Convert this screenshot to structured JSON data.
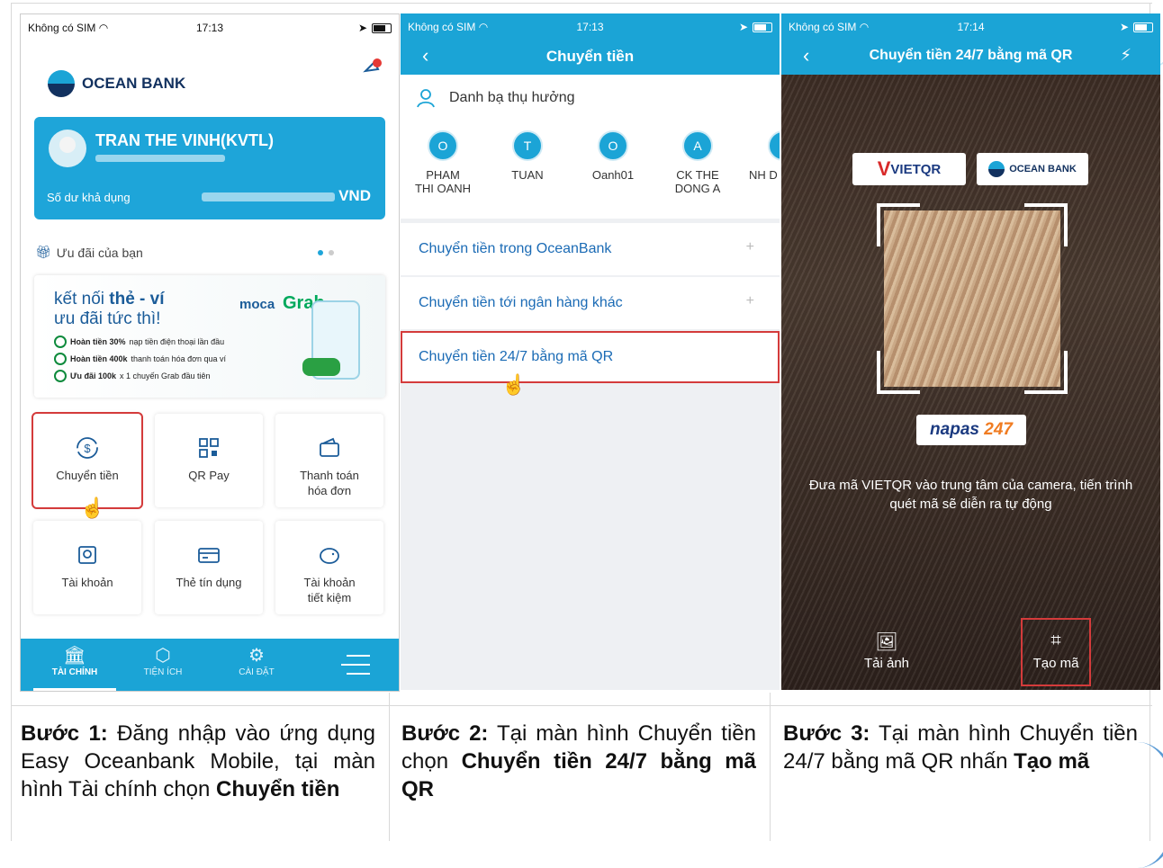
{
  "status1": {
    "carrier": "Không có SIM",
    "time": "17:13"
  },
  "status2": {
    "carrier": "Không có SIM",
    "time": "17:13"
  },
  "status3": {
    "carrier": "Không có SIM",
    "time": "17:14"
  },
  "screen1": {
    "brand": "OCEAN BANK",
    "account_name": "TRAN THE VINH(KVTL)",
    "balance_label": "Số dư khả dụng",
    "balance_currency": "VND",
    "promo_title": "Ưu đãi của bạn",
    "banner": {
      "line1_prefix": "kết nối ",
      "line1_bold": "thẻ - ví",
      "line2": "ưu đãi tức thì!",
      "moca": "moca",
      "grab": "Grab",
      "items": [
        {
          "bold": "Hoàn tiền 30%",
          "text": " nạp tiền điện thoại lần đầu"
        },
        {
          "bold": "Hoàn tiền 400k",
          "text": " thanh toán hóa đơn qua ví"
        },
        {
          "bold": "Ưu đãi 100k",
          "text": " x 1 chuyến Grab đầu tiên"
        }
      ]
    },
    "tiles": [
      "Chuyển tiền",
      "QR Pay",
      "Thanh toán\nhóa đơn",
      "Tài khoản",
      "Thẻ tín dụng",
      "Tài khoản\ntiết kiệm"
    ],
    "nav": [
      "TÀI CHÍNH",
      "TIỆN ÍCH",
      "CÀI ĐẶT"
    ]
  },
  "screen2": {
    "title": "Chuyển tiền",
    "contacts_title": "Danh bạ thụ hưởng",
    "contacts": [
      {
        "initial": "O",
        "name": "PHAM\nTHI OANH"
      },
      {
        "initial": "T",
        "name": "TUAN"
      },
      {
        "initial": "O",
        "name": "Oanh01"
      },
      {
        "initial": "A",
        "name": "CK THE\nDONG A"
      },
      {
        "initial": "",
        "name": "NH D"
      }
    ],
    "menu": [
      "Chuyển tiền trong OceanBank",
      "Chuyển tiền tới ngân hàng khác",
      "Chuyển tiền 24/7 bằng mã QR"
    ]
  },
  "screen3": {
    "title": "Chuyển tiền 24/7 bằng mã QR",
    "vietqr": "VIETQR",
    "oceanbank": "OCEAN BANK",
    "napas_a": "napas ",
    "napas_b": "247",
    "hint": "Đưa mã VIETQR vào trung tâm của camera, tiến trình quét mã sẽ diễn ra tự động",
    "upload": "Tải ảnh",
    "create": "Tạo mã"
  },
  "captions": {
    "step1_label": "Bước 1:",
    "step1_text": " Đăng nhập vào ứng dụng Easy Oceanbank Mobile, tại màn hình Tài chính chọn ",
    "step1_bold": "Chuyển tiền",
    "step2_label": "Bước 2:",
    "step2_text": " Tại màn hình Chuyển tiền chọn ",
    "step2_bold": "Chuyển tiền 24/7 bằng mã QR",
    "step3_label": "Bước 3:",
    "step3_text": " Tại màn hình Chuyển tiền 24/7 bằng mã QR nhấn ",
    "step3_bold": "Tạo mã"
  },
  "colors": {
    "accent": "#1ba4d6",
    "highlight": "#d43b3b",
    "navy": "#12315f"
  }
}
